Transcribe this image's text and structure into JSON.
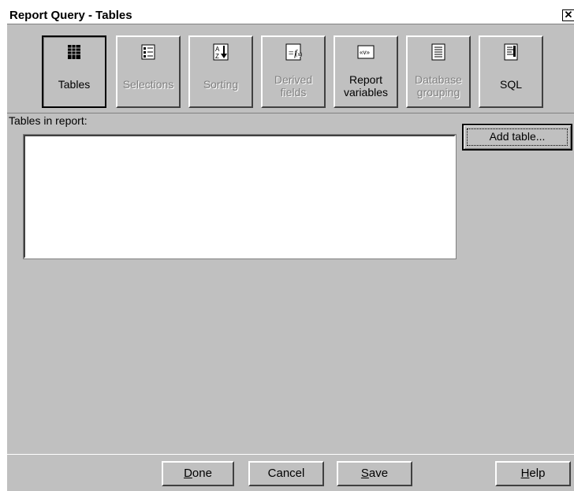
{
  "window": {
    "title": "Report Query - Tables",
    "close_glyph": "✕"
  },
  "toolbar": [
    {
      "key": "tables",
      "label1": "Tables",
      "label2": "",
      "enabled": true,
      "active": true,
      "icon": "table-grid-icon"
    },
    {
      "key": "selections",
      "label1": "Selections",
      "label2": "",
      "enabled": false,
      "active": false,
      "icon": "checklist-icon"
    },
    {
      "key": "sorting",
      "label1": "Sorting",
      "label2": "",
      "enabled": false,
      "active": false,
      "icon": "sort-az-icon"
    },
    {
      "key": "derived",
      "label1": "Derived",
      "label2": "fields",
      "enabled": false,
      "active": false,
      "icon": "function-icon"
    },
    {
      "key": "variables",
      "label1": "Report",
      "label2": "variables",
      "enabled": true,
      "active": false,
      "icon": "variable-icon"
    },
    {
      "key": "grouping",
      "label1": "Database",
      "label2": "grouping",
      "enabled": false,
      "active": false,
      "icon": "document-lines-icon"
    },
    {
      "key": "sql",
      "label1": "SQL",
      "label2": "",
      "enabled": true,
      "active": false,
      "icon": "sql-document-icon"
    }
  ],
  "main": {
    "tables_label": "Tables in report:",
    "add_table_label": "Add table..."
  },
  "buttons": {
    "done_first": "D",
    "done_rest": "one",
    "cancel": "Cancel",
    "save_first": "S",
    "save_rest": "ave",
    "help_first": "H",
    "help_rest": "elp"
  }
}
